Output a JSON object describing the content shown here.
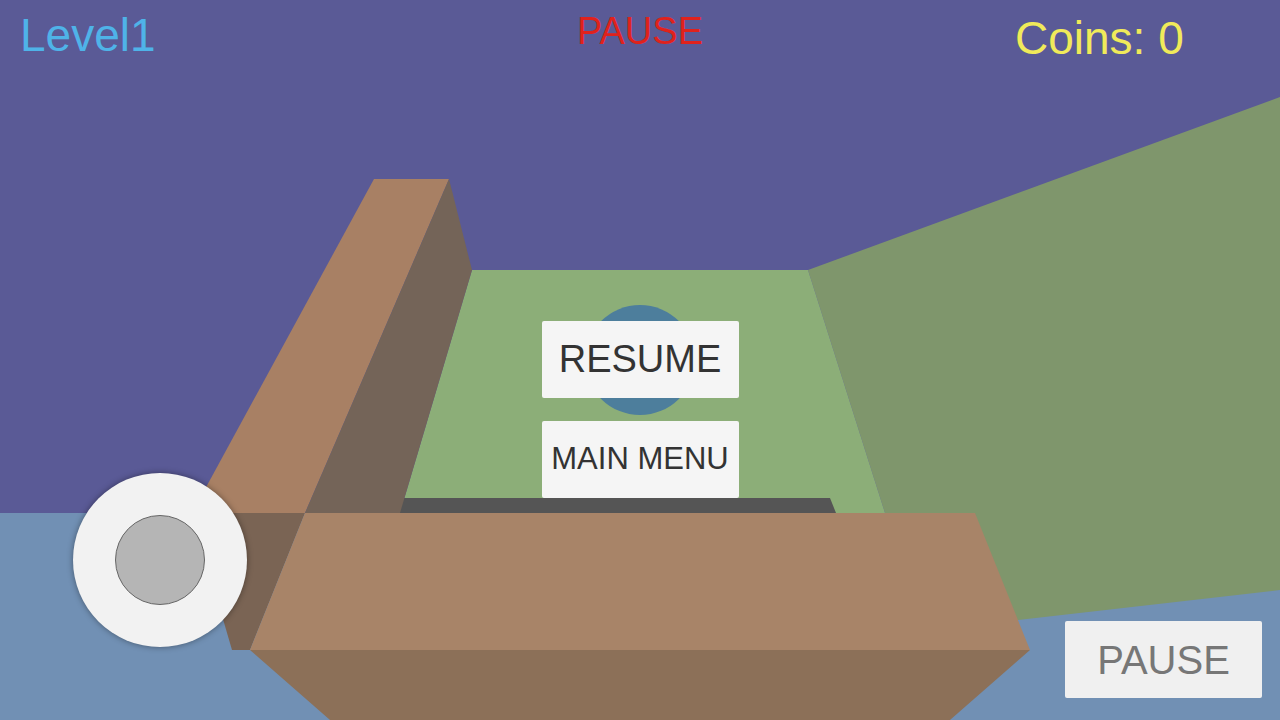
{
  "hud": {
    "level": "Level1",
    "title": "PAUSE",
    "coins": "Coins: 0"
  },
  "menu": {
    "buttons": [
      "RESUME",
      "MAIN MENU"
    ]
  },
  "pause_button": {
    "label": "PAUSE"
  }
}
